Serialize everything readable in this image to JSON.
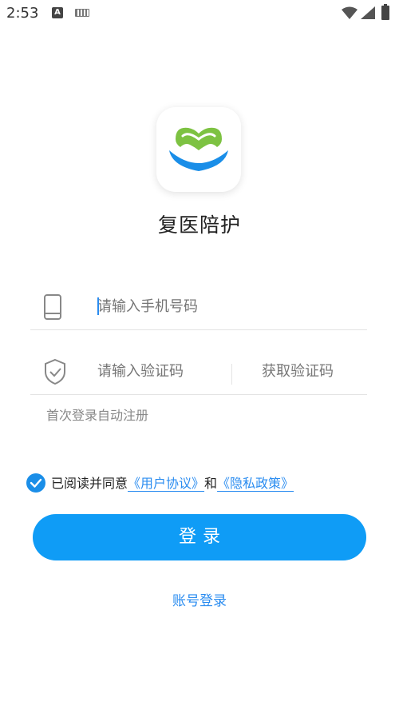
{
  "status_bar": {
    "time": "2:53",
    "a_icon": "A",
    "icons": [
      "a-notification-icon",
      "keyboard-icon",
      "wifi-icon",
      "signal-icon",
      "battery-icon"
    ]
  },
  "app": {
    "name": "复医陪护",
    "logo_icon": "app-logo-icon"
  },
  "form": {
    "phone_placeholder": "请输入手机号码",
    "code_placeholder": "请输入验证码",
    "get_code_label": "获取验证码",
    "hint": "首次登录自动注册"
  },
  "agreement": {
    "checked": true,
    "prefix": "已阅读并同意",
    "user_agreement": "《用户协议》",
    "and": "和",
    "privacy_policy": "《隐私政策》"
  },
  "actions": {
    "login_label": "登录",
    "account_login_label": "账号登录"
  },
  "colors": {
    "primary": "#0f9cf6",
    "link": "#2a8cf0",
    "logo_green": "#7dc242",
    "logo_blue": "#1a8ee8"
  }
}
